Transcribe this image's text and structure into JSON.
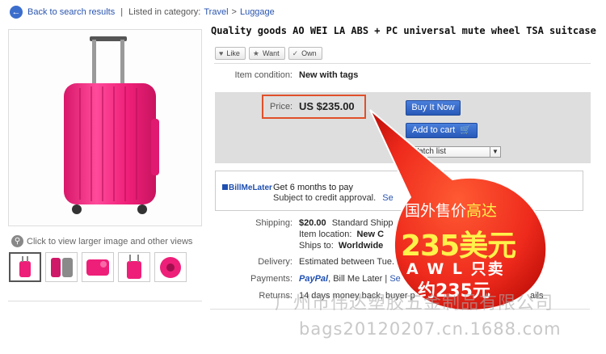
{
  "breadcrumb": {
    "back_label": "Back to search results",
    "listed_label": "Listed in category:",
    "category": "Travel",
    "separator": ">",
    "subcategory": "Luggage"
  },
  "gallery": {
    "enlarge_label": "Click to view larger image and other views",
    "thumbnail_count": 5
  },
  "title": "Quality goods AO WEI LA ABS + PC universal mute wheel TSA suitcase",
  "social": {
    "like": "Like",
    "want": "Want",
    "own": "Own"
  },
  "condition": {
    "label": "Item condition:",
    "value": "New with tags"
  },
  "price": {
    "label": "Price:",
    "value": "US $235.00"
  },
  "actions": {
    "buy_now": "Buy It Now",
    "add_to_cart": "Add to cart",
    "watch_list": "Watch list"
  },
  "bill_me_later": {
    "logo": "BillMeLater",
    "headline": "Get 6 months to pay",
    "subtext": "Subject to credit approval.",
    "link": "Se"
  },
  "shipping": {
    "label": "Shipping:",
    "cost": "$20.00",
    "method": "Standard Shipp",
    "location_label": "Item location:",
    "location": "New C",
    "ships_to_label": "Ships to:",
    "ships_to": "Worldwide"
  },
  "delivery": {
    "label": "Delivery:",
    "value": "Estimated between Tue."
  },
  "payments": {
    "label": "Payments:",
    "paypal": "PayPal",
    "rest": ", Bill Me Later |",
    "link": "Se"
  },
  "returns": {
    "label": "Returns:",
    "value": "14 days money back, buyer p",
    "link": "ails"
  },
  "ad_overlay": {
    "line1_white": "国外售价",
    "line1_yellow": "高达",
    "line2": "235美元",
    "line3": "A W L 只卖",
    "line4": "约235元"
  },
  "watermark": {
    "company": "广州市伟达塑胶五金制品有限公司",
    "site": "bags20120207.cn.1688.com"
  },
  "colors": {
    "link_blue": "#2a55b0",
    "suitcase_pink": "#ee1f78",
    "bubble_red": "#ee2a1c",
    "highlight_yellow": "#fff24a",
    "button_blue": "#2859b8"
  }
}
